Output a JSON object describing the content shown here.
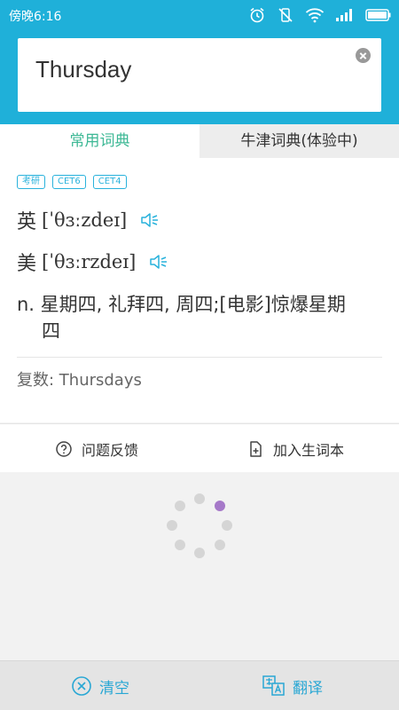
{
  "status_bar": {
    "time": "傍晚6:16",
    "icons": [
      "alarm-icon",
      "mute-icon",
      "wifi-icon",
      "signal-icon",
      "battery-icon"
    ]
  },
  "search": {
    "query": "Thursday"
  },
  "tabs": [
    {
      "label": "常用词典",
      "active": true
    },
    {
      "label": "牛津词典(体验中)",
      "active": false
    }
  ],
  "entry": {
    "tags": [
      "考研",
      "CET6",
      "CET4"
    ],
    "uk": {
      "label": "英",
      "ipa": "[ˈθɜːzdeɪ]"
    },
    "us": {
      "label": "美",
      "ipa": "[ˈθɜːrzdeɪ]"
    },
    "definition_line1": "n. 星期四, 礼拜四, 周四;[电影]惊爆星期",
    "definition_line2": "四",
    "plural": "复数: Thursdays"
  },
  "actions": {
    "feedback_label": "问题反馈",
    "add_wordbook_label": "加入生词本"
  },
  "bottom_bar": {
    "clear_label": "清空",
    "translate_label": "翻译"
  },
  "colors": {
    "header": "#1fb0d9",
    "tab_active_text": "#3db895",
    "accent": "#29a7d4",
    "loader_active": "#a679c9"
  }
}
